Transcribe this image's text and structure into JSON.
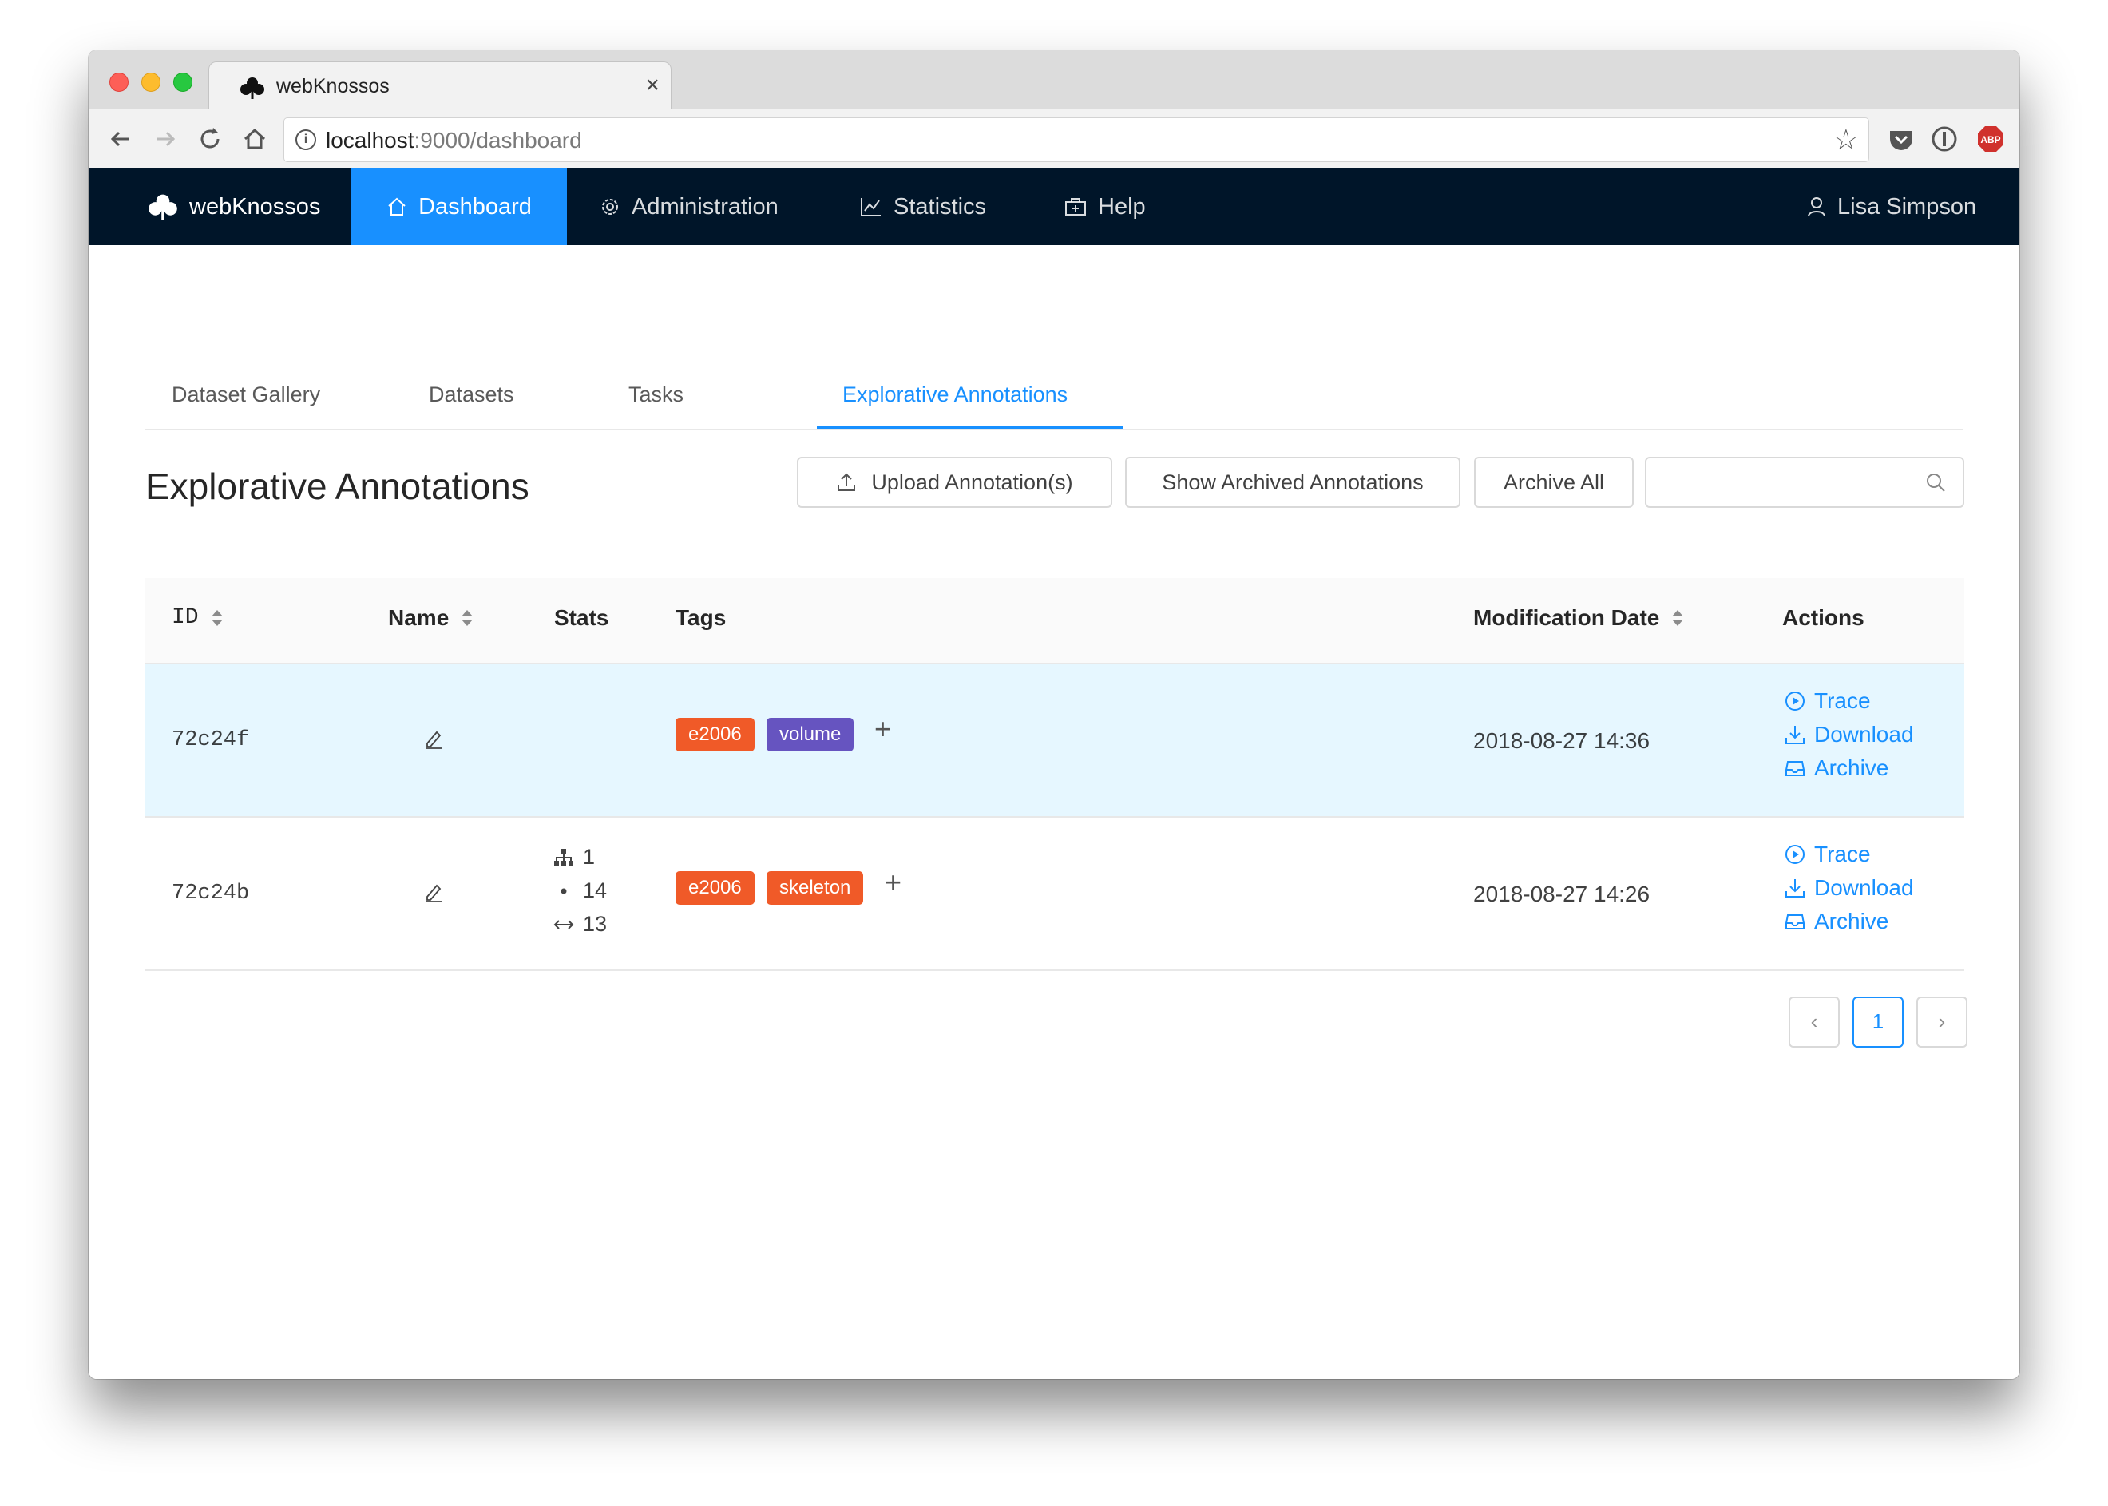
{
  "browser": {
    "tab_title": "webKnossos",
    "tab_close": "×",
    "url_host": "localhost",
    "url_rest": ":9000/dashboard",
    "star": "☆"
  },
  "navbar": {
    "brand": "webKnossos",
    "items": [
      {
        "label": "Dashboard",
        "icon": "home-icon",
        "active": true
      },
      {
        "label": "Administration",
        "icon": "gear-icon",
        "active": false
      },
      {
        "label": "Statistics",
        "icon": "line-chart-icon",
        "active": false
      },
      {
        "label": "Help",
        "icon": "medicine-box-icon",
        "active": false
      }
    ],
    "user": "Lisa Simpson"
  },
  "subtabs": [
    {
      "label": "Dataset Gallery",
      "active": false
    },
    {
      "label": "Datasets",
      "active": false
    },
    {
      "label": "Tasks",
      "active": false
    },
    {
      "label": "Explorative Annotations",
      "active": true
    }
  ],
  "page": {
    "title": "Explorative Annotations",
    "upload_label": "Upload Annotation(s)",
    "show_archived_label": "Show Archived Annotations",
    "archive_all_label": "Archive All",
    "search_placeholder": ""
  },
  "table": {
    "columns": [
      "ID",
      "Name",
      "Stats",
      "Tags",
      "Modification Date",
      "Actions"
    ],
    "rows": [
      {
        "id": "72c24f",
        "stats": null,
        "tags": [
          {
            "label": "e2006",
            "color": "#f05a28"
          },
          {
            "label": "volume",
            "color": "#6654c0"
          }
        ],
        "date": "2018-08-27 14:36",
        "actions": [
          "Trace",
          "Download",
          "Archive"
        ]
      },
      {
        "id": "72c24b",
        "stats": {
          "trees": "1",
          "nodes": "14",
          "edges": "13"
        },
        "tags": [
          {
            "label": "e2006",
            "color": "#f05a28"
          },
          {
            "label": "skeleton",
            "color": "#f05a28"
          }
        ],
        "date": "2018-08-27 14:26",
        "actions": [
          "Trace",
          "Download",
          "Archive"
        ]
      }
    ],
    "tag_add": "+"
  },
  "pagination": {
    "prev": "‹",
    "current": "1",
    "next": "›"
  },
  "colors": {
    "navbar_bg": "#001529",
    "accent": "#1890ff",
    "row_highlight": "#e6f7ff"
  }
}
